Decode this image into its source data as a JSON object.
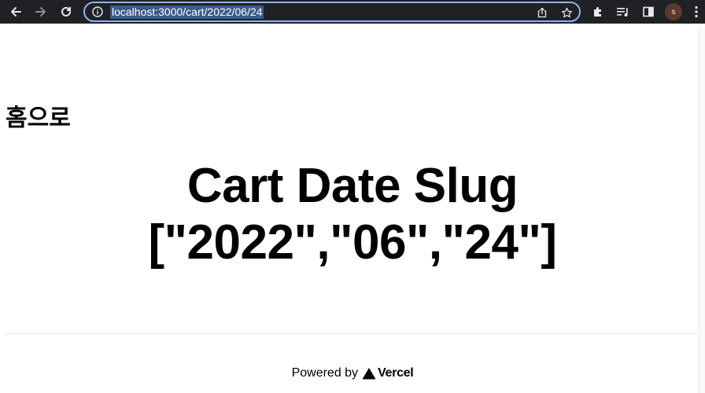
{
  "browser": {
    "url": "localhost:3000/cart/2022/06/24",
    "profile_initial": "s",
    "icons": {
      "back": "back-arrow-icon",
      "forward": "forward-arrow-icon",
      "reload": "reload-icon",
      "site_info": "info-icon",
      "share": "share-icon",
      "bookmark": "star-icon",
      "extensions": "puzzle-icon",
      "media": "media-queue-icon",
      "side_panel": "side-panel-icon",
      "menu": "kebab-menu-icon"
    },
    "colors": {
      "chrome": "#202124",
      "focus_ring": "#8ab4f8",
      "selection": "#3d5a8a"
    }
  },
  "page": {
    "home_link": "홈으로",
    "title_line1": "Cart Date Slug",
    "title_line2": "[\"2022\",\"06\",\"24\"]",
    "footer_text": "Powered by",
    "footer_brand": "Vercel"
  }
}
